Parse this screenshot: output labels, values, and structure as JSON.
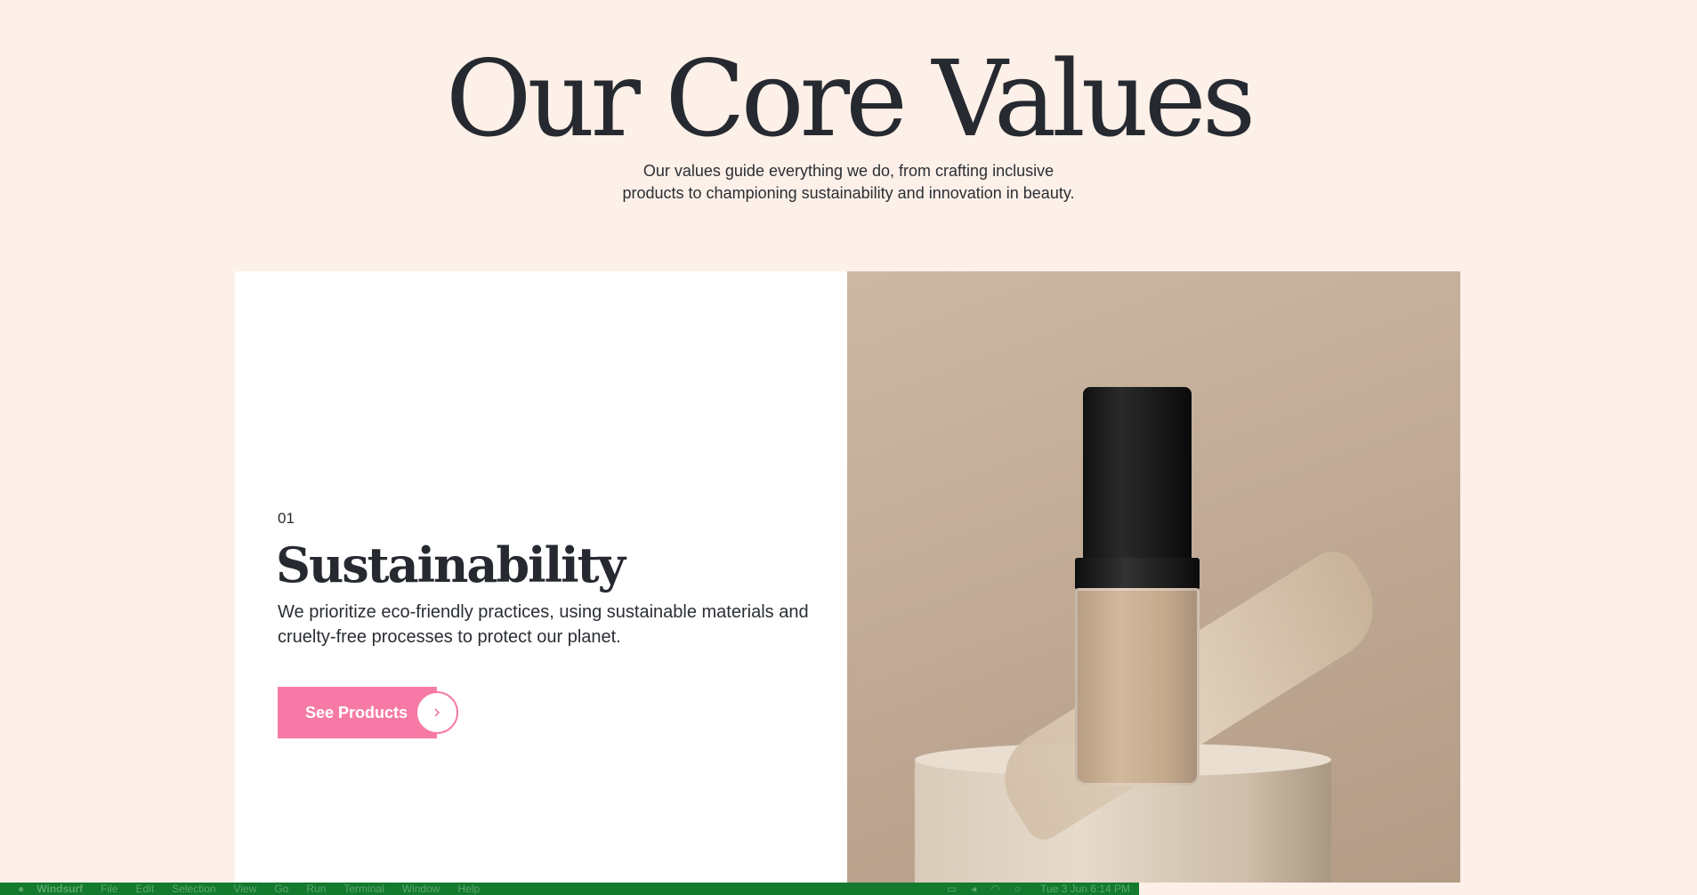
{
  "hero": {
    "title": "Our Core Values",
    "subtitle_line1": "Our values guide everything we do, from crafting inclusive",
    "subtitle_line2": "products to championing sustainability and innovation in beauty."
  },
  "value_card": {
    "number": "01",
    "title": "Sustainability",
    "description": "We prioritize eco-friendly practices, using sustainable materials and cruelty-free processes to protect our planet.",
    "cta_label": "See Products",
    "cta_icon": "chevron-right-icon"
  },
  "colors": {
    "background": "#fdf0e8",
    "accent": "#f67aa5",
    "text": "#262a30",
    "taskbar": "#137a2e"
  },
  "taskbar": {
    "app_name": "Windsurf",
    "menus": [
      "File",
      "Edit",
      "Selection",
      "View",
      "Go",
      "Run",
      "Terminal",
      "Window",
      "Help"
    ],
    "clock": "Tue 3 Jun  6:14 PM"
  }
}
